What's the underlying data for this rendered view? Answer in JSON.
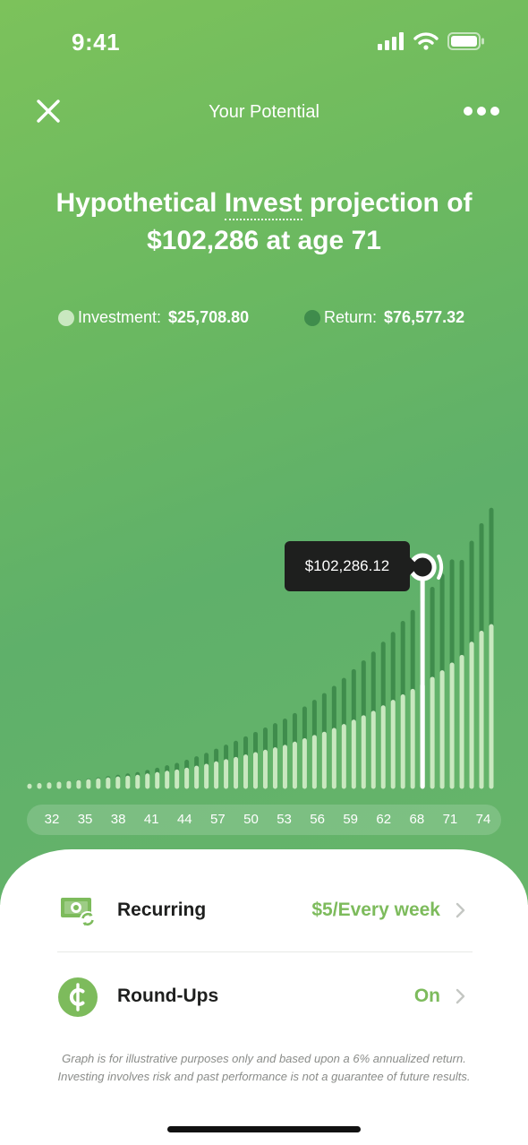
{
  "status_bar": {
    "time": "9:41"
  },
  "nav": {
    "title": "Your Potential"
  },
  "headline": {
    "prefix": "Hypothetical ",
    "term": "Invest",
    "suffix": " projection of",
    "line2": "$102,286 at age 71"
  },
  "legend": {
    "investment_label": "Investment:",
    "investment_value": "$25,708.80",
    "return_label": "Return:",
    "return_value": "$76,577.32"
  },
  "colors": {
    "investment": "#c9e8c0",
    "return": "#3f8c4c",
    "accent": "#7dbb5c",
    "tooltip_bg": "#1e1f1e"
  },
  "chart_data": {
    "type": "bar",
    "stacked": true,
    "selected_age": 71,
    "tooltip": "$102,286.12",
    "x_tick_labels": [
      "32",
      "35",
      "38",
      "41",
      "44",
      "57",
      "50",
      "53",
      "56",
      "59",
      "62",
      "68",
      "71",
      "74"
    ],
    "series": [
      {
        "name": "Investment",
        "values": [
          0.3,
          0.6,
          0.9,
          1.2,
          1.6,
          2.0,
          2.4,
          2.8,
          3.2,
          3.6,
          4.0,
          4.4,
          5.0,
          5.6,
          6.2,
          6.8,
          7.6,
          8.5,
          9.4,
          10.5,
          11.5,
          12.5,
          13.6,
          14.7,
          15.8,
          16.9,
          18.0,
          19.5,
          21.0,
          22.5,
          24.0,
          25.7,
          27.5,
          29.5,
          31.5,
          33.5,
          36.0,
          38.5,
          41.0,
          43.5,
          46.0,
          49.0,
          52.0,
          55.5,
          59.0,
          65.0,
          70.0,
          73.0
        ]
      },
      {
        "name": "Return",
        "values": [
          0.0,
          0.0,
          0.0,
          0.0,
          0.1,
          0.2,
          0.3,
          0.4,
          0.6,
          0.8,
          1.0,
          1.2,
          1.6,
          2.0,
          2.5,
          3.0,
          3.6,
          4.3,
          5.0,
          5.8,
          6.6,
          7.4,
          8.3,
          9.2,
          10.1,
          11.0,
          12.0,
          13.0,
          14.5,
          16.0,
          17.6,
          19.2,
          21.0,
          23.0,
          25.0,
          27.0,
          29.0,
          31.0,
          33.5,
          36.0,
          38.5,
          41.0,
          44.0,
          47.0,
          43.3,
          46.0,
          49.0,
          53.0
        ]
      }
    ]
  },
  "rows": [
    {
      "label": "Recurring",
      "value": "$5/Every week",
      "icon": "cash-recurring-icon"
    },
    {
      "label": "Round-Ups",
      "value": "On",
      "icon": "cent-coin-icon"
    }
  ],
  "disclaimer": {
    "line1": "Graph is for illustrative purposes only and based upon a 6% annualized return.",
    "line2": "Investing involves risk and past performance is not a guarantee of future results."
  }
}
